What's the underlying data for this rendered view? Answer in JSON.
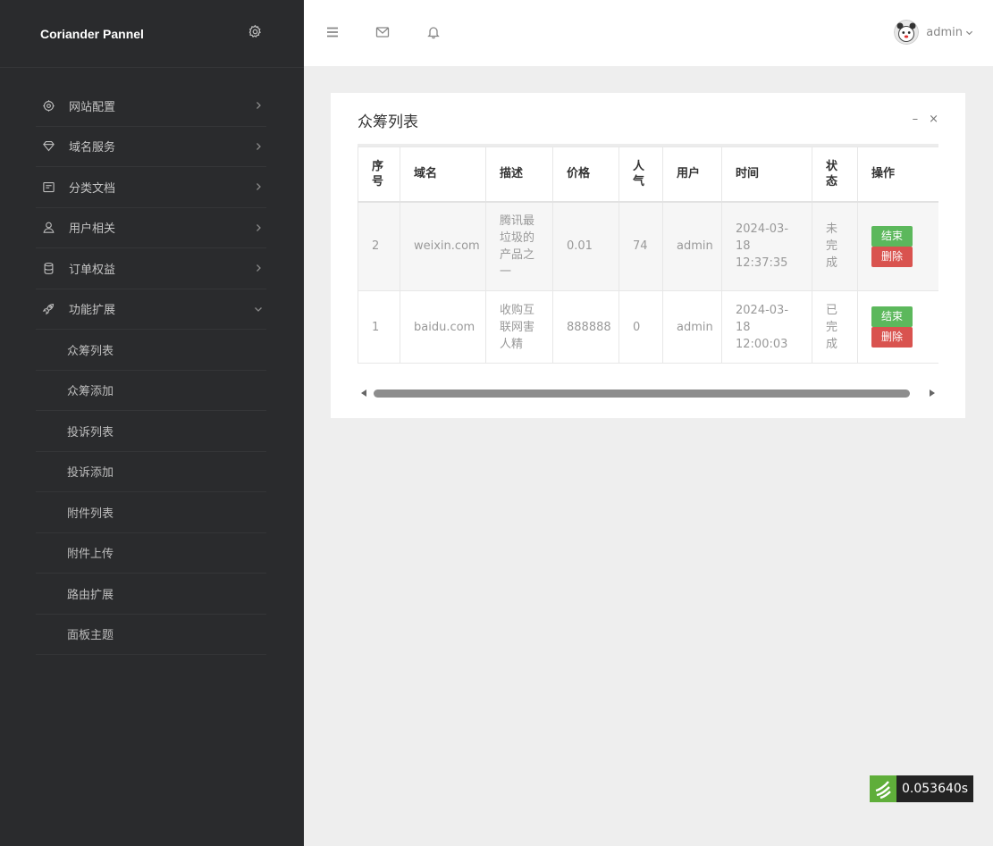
{
  "brand": {
    "title": "Coriander Pannel",
    "settings_icon": "gear-icon"
  },
  "sidebar": {
    "items": [
      {
        "label": "网站配置",
        "icon": "gear-icon",
        "expanded": false
      },
      {
        "label": "域名服务",
        "icon": "diamond-icon",
        "expanded": false
      },
      {
        "label": "分类文档",
        "icon": "document-icon",
        "expanded": false
      },
      {
        "label": "用户相关",
        "icon": "user-icon",
        "expanded": false
      },
      {
        "label": "订单权益",
        "icon": "database-icon",
        "expanded": false
      },
      {
        "label": "功能扩展",
        "icon": "rocket-icon",
        "expanded": true
      }
    ],
    "subitems": [
      "众筹列表",
      "众筹添加",
      "投诉列表",
      "投诉添加",
      "附件列表",
      "附件上传",
      "路由扩展",
      "面板主题"
    ]
  },
  "topbar": {
    "icons": [
      "menu-icon",
      "mail-icon",
      "bell-icon"
    ],
    "user": {
      "name": "admin"
    }
  },
  "card": {
    "title": "众筹列表",
    "minimize": "–",
    "close": "×",
    "table": {
      "headers": [
        "序号",
        "域名",
        "描述",
        "价格",
        "人气",
        "用户",
        "时间",
        "状态",
        "操作"
      ],
      "rows": [
        {
          "id": "2",
          "domain": "weixin.com",
          "desc": "腾讯最垃圾的产品之一",
          "price": "0.01",
          "popularity": "74",
          "user": "admin",
          "time": "2024-03-18 12:37:35",
          "status": "未完成",
          "end_label": "结束",
          "delete_label": "删除"
        },
        {
          "id": "1",
          "domain": "baidu.com",
          "desc": "收购互联网害人精",
          "price": "888888",
          "popularity": "0",
          "user": "admin",
          "time": "2024-03-18 12:00:03",
          "status": "已完成",
          "end_label": "结束",
          "delete_label": "删除"
        }
      ]
    }
  },
  "timer": {
    "value": "0.053640s"
  },
  "colors": {
    "sidebar_bg": "#2a2b2d",
    "end_button": "#5cb85c",
    "delete_button": "#d9534f",
    "timer_logo": "#5fae3a"
  }
}
